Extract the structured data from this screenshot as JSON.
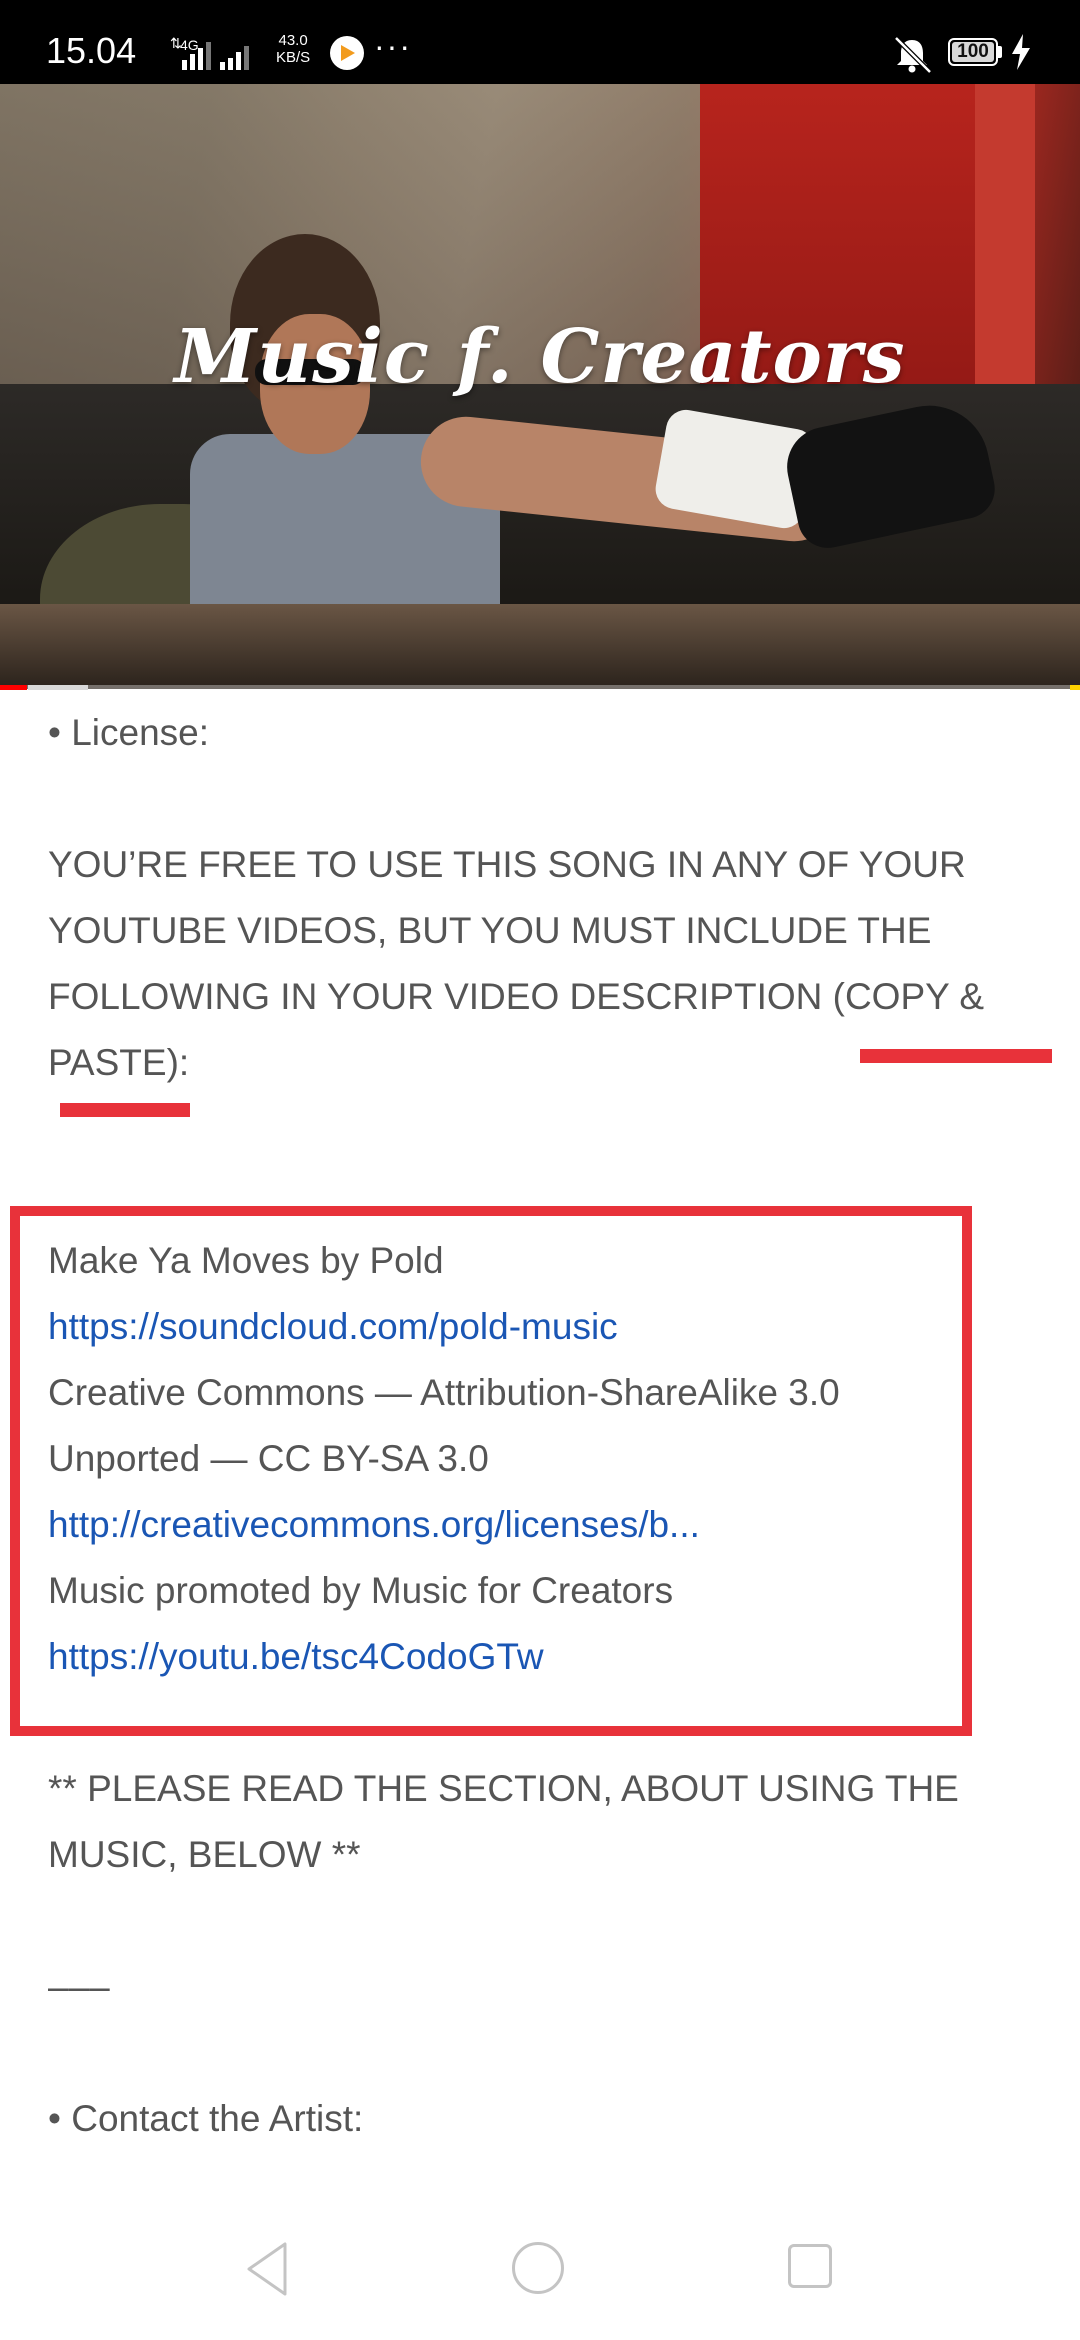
{
  "status_bar": {
    "time": "15.04",
    "network_type": "4G",
    "speed_value": "43.0",
    "speed_unit": "KB/S",
    "more": "···",
    "battery": "100"
  },
  "video": {
    "title_overlay": "Music f. Creators",
    "progress_fraction": 0.025
  },
  "description": {
    "license_heading": "• License:",
    "license_text": [
      "YOU’RE FREE TO USE THIS SONG IN ANY OF YOUR",
      "YOUTUBE VIDEOS, BUT YOU MUST INCLUDE THE",
      "FOLLOWING IN YOUR VIDEO DESCRIPTION (COPY &",
      "PASTE):"
    ],
    "credit_song": "Make Ya Moves by Pold",
    "credit_artist_link": "https://soundcloud.com/pold-music",
    "credit_license_1": "Creative Commons — Attribution-ShareAlike 3.0",
    "credit_license_2": "Unported  — CC BY-SA 3.0",
    "credit_license_link": "http://creativecommons.org/licenses/b...",
    "credit_promoted": "Music promoted by Music for Creators",
    "credit_video_link": "https://youtu.be/tsc4CodoGTw",
    "notice_1": "** PLEASE READ THE SECTION, ABOUT USING THE",
    "notice_2": "MUSIC, BELOW **",
    "separator": "–––",
    "contact_heading": "• Contact the Artist:"
  },
  "colors": {
    "annotation_red": "#e8323a",
    "link_blue": "#1a56b4",
    "progress_red": "#ff0000"
  }
}
